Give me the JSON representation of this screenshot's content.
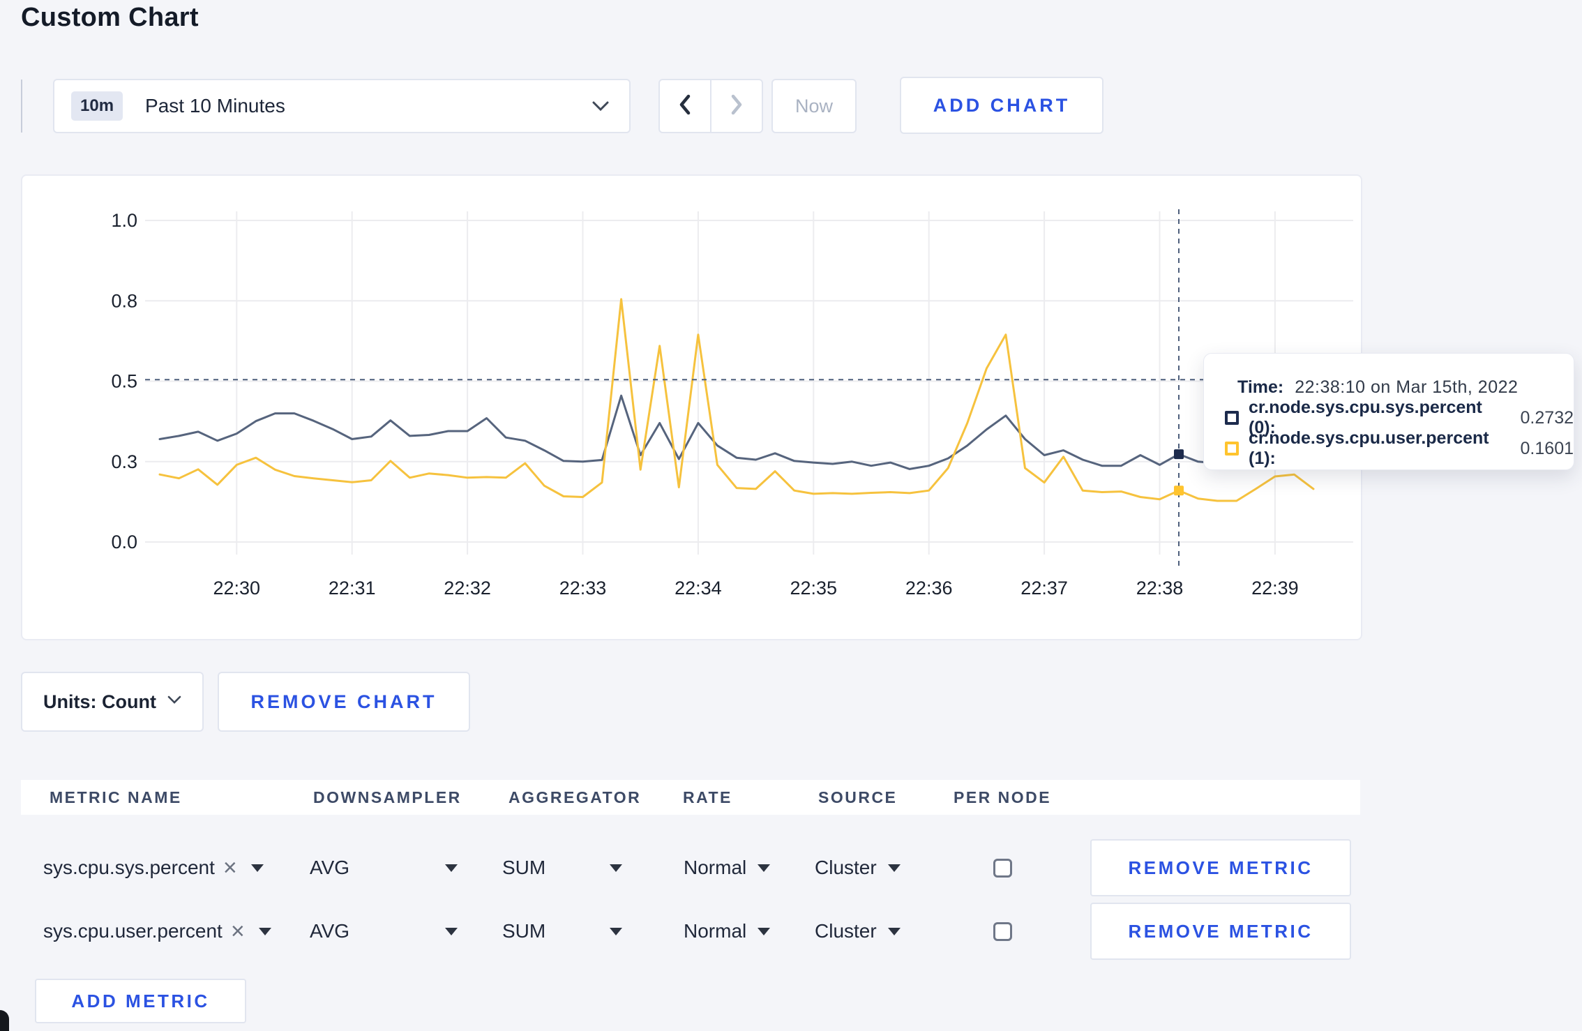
{
  "page": {
    "title": "Custom Chart"
  },
  "toolbar": {
    "time_range": {
      "badge": "10m",
      "label": "Past 10 Minutes"
    },
    "now_label": "Now",
    "add_chart_label": "ADD CHART"
  },
  "chart_data": {
    "type": "line",
    "title": "",
    "xlabel": "",
    "ylabel": "",
    "ylim": [
      0,
      1
    ],
    "grid": true,
    "x_ticks": [
      "22:30",
      "22:31",
      "22:32",
      "22:33",
      "22:34",
      "22:35",
      "22:36",
      "22:37",
      "22:38",
      "22:39"
    ],
    "y_ticks": [
      {
        "value": 0,
        "label": "0.0"
      },
      {
        "value": 0.25,
        "label": "0.3"
      },
      {
        "value": 0.5,
        "label": "0.5"
      },
      {
        "value": 0.75,
        "label": "0.8"
      },
      {
        "value": 1,
        "label": "1.0"
      }
    ],
    "x": [
      "22:29:20",
      "22:29:30",
      "22:29:40",
      "22:29:50",
      "22:30:00",
      "22:30:10",
      "22:30:20",
      "22:30:30",
      "22:30:40",
      "22:30:50",
      "22:31:00",
      "22:31:10",
      "22:31:20",
      "22:31:30",
      "22:31:40",
      "22:31:50",
      "22:32:00",
      "22:32:10",
      "22:32:20",
      "22:32:30",
      "22:32:40",
      "22:32:50",
      "22:33:00",
      "22:33:10",
      "22:33:20",
      "22:33:30",
      "22:33:40",
      "22:33:50",
      "22:34:00",
      "22:34:10",
      "22:34:20",
      "22:34:30",
      "22:34:40",
      "22:34:50",
      "22:35:00",
      "22:35:10",
      "22:35:20",
      "22:35:30",
      "22:35:40",
      "22:35:50",
      "22:36:00",
      "22:36:10",
      "22:36:20",
      "22:36:30",
      "22:36:40",
      "22:36:50",
      "22:37:00",
      "22:37:10",
      "22:37:20",
      "22:37:30",
      "22:37:40",
      "22:37:50",
      "22:38:00",
      "22:38:10",
      "22:38:20",
      "22:38:30",
      "22:38:40",
      "22:38:50",
      "22:39:00",
      "22:39:10",
      "22:39:20"
    ],
    "series": [
      {
        "name": "cr.node.sys.cpu.sys.percent (0)",
        "color": "#56647d",
        "swatch": "#1d2b4d",
        "values": [
          0.32,
          0.33,
          0.343,
          0.315,
          0.337,
          0.376,
          0.4,
          0.4,
          0.377,
          0.351,
          0.32,
          0.328,
          0.378,
          0.33,
          0.333,
          0.345,
          0.345,
          0.385,
          0.325,
          0.315,
          0.285,
          0.252,
          0.25,
          0.255,
          0.455,
          0.27,
          0.37,
          0.258,
          0.37,
          0.3,
          0.262,
          0.256,
          0.276,
          0.252,
          0.247,
          0.243,
          0.25,
          0.237,
          0.247,
          0.227,
          0.237,
          0.26,
          0.3,
          0.35,
          0.393,
          0.32,
          0.27,
          0.285,
          0.256,
          0.237,
          0.237,
          0.27,
          0.24,
          0.2732,
          0.25,
          0.245,
          0.25,
          0.255,
          0.25,
          0.252,
          0.255
        ]
      },
      {
        "name": "cr.node.sys.cpu.user.percent (1)",
        "color": "#f6c23e",
        "swatch": "#ffc42e",
        "values": [
          0.21,
          0.198,
          0.226,
          0.178,
          0.24,
          0.262,
          0.225,
          0.205,
          0.198,
          0.192,
          0.186,
          0.192,
          0.252,
          0.2,
          0.213,
          0.208,
          0.2,
          0.202,
          0.2,
          0.245,
          0.175,
          0.142,
          0.14,
          0.185,
          0.755,
          0.225,
          0.61,
          0.17,
          0.645,
          0.24,
          0.168,
          0.165,
          0.22,
          0.16,
          0.15,
          0.152,
          0.15,
          0.153,
          0.155,
          0.152,
          0.16,
          0.23,
          0.37,
          0.54,
          0.645,
          0.23,
          0.185,
          0.265,
          0.16,
          0.155,
          0.157,
          0.14,
          0.133,
          0.1601,
          0.135,
          0.128,
          0.128,
          0.165,
          0.204,
          0.21,
          0.165
        ]
      }
    ],
    "crosshair": {
      "time": "22:38:10",
      "hover_value": 0.505
    },
    "legend_position": "tooltip"
  },
  "tooltip": {
    "time_label": "Time:",
    "time_value": "22:38:10 on Mar 15th, 2022",
    "rows": [
      {
        "label": "cr.node.sys.cpu.sys.percent (0):",
        "value": "0.2732"
      },
      {
        "label": "cr.node.sys.cpu.user.percent (1):",
        "value": "0.1601"
      }
    ]
  },
  "chart_controls": {
    "units_label": "Units: Count",
    "remove_chart_label": "REMOVE CHART"
  },
  "metrics_table": {
    "headers": [
      "METRIC NAME",
      "DOWNSAMPLER",
      "AGGREGATOR",
      "RATE",
      "SOURCE",
      "PER NODE"
    ],
    "rows": [
      {
        "name": "sys.cpu.sys.percent",
        "downsampler": "AVG",
        "aggregator": "SUM",
        "rate": "Normal",
        "source": "Cluster",
        "per_node_checked": false
      },
      {
        "name": "sys.cpu.user.percent",
        "downsampler": "AVG",
        "aggregator": "SUM",
        "rate": "Normal",
        "source": "Cluster",
        "per_node_checked": false
      }
    ],
    "remove_metric_label": "REMOVE METRIC",
    "add_metric_label": "ADD METRIC"
  },
  "icons": {
    "close": "×"
  },
  "colors": {
    "accent_blue": "#2b52e2",
    "series_sys": "#56647d",
    "series_user": "#f6c23e",
    "page_bg": "#f4f5f9",
    "grid_line": "#ececef",
    "crosshair": "#4e5f7c"
  }
}
